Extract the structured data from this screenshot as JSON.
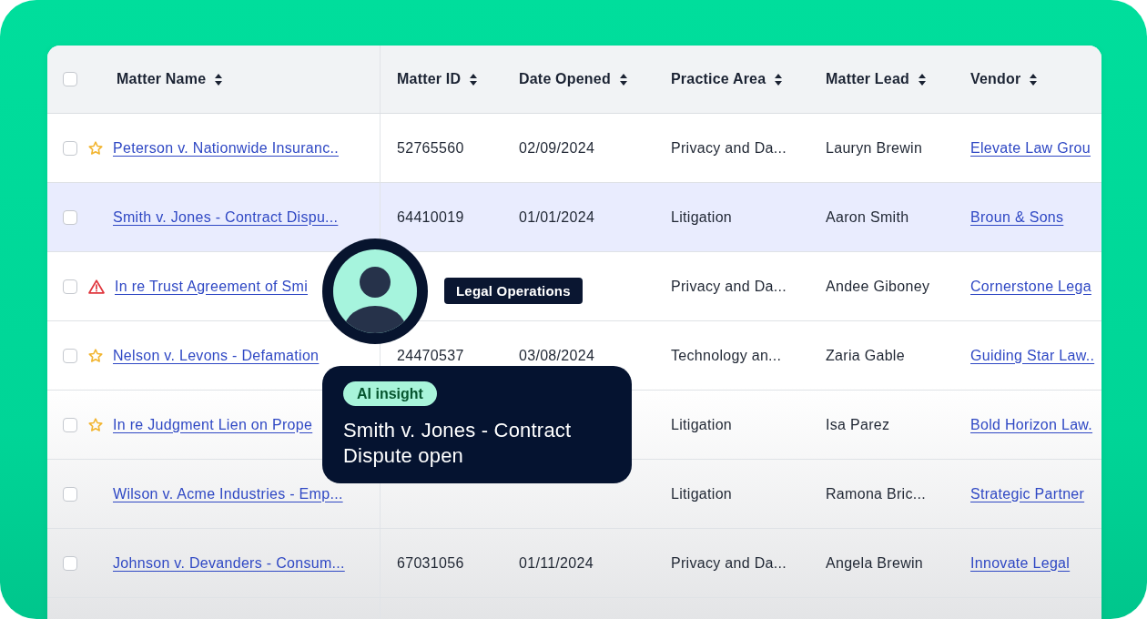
{
  "table": {
    "header_checkbox": {
      "checked": false
    },
    "columns": [
      "Matter Name",
      "Matter ID",
      "Date Opened",
      "Practice Area",
      "Matter Lead",
      "Vendor"
    ],
    "rows": [
      {
        "checked": false,
        "starred": true,
        "alert": false,
        "highlighted": false,
        "matter_name": "Peterson v. Nationwide Insuranc..",
        "matter_id": "52765560",
        "date_opened": "02/09/2024",
        "practice_area": "Privacy and Da...",
        "matter_lead": "Lauryn Brewin",
        "vendor": "Elevate Law Grou"
      },
      {
        "checked": false,
        "starred": false,
        "alert": false,
        "highlighted": true,
        "matter_name": "Smith v. Jones - Contract Dispu...",
        "matter_id": "64410019",
        "date_opened": "01/01/2024",
        "practice_area": "Litigation",
        "matter_lead": "Aaron Smith",
        "vendor": "Broun & Sons"
      },
      {
        "checked": false,
        "starred": false,
        "alert": true,
        "highlighted": false,
        "matter_name": "In re Trust Agreement of Smi",
        "practice_area": "Privacy and Da...",
        "matter_lead": "Andee Giboney",
        "vendor": "Cornerstone Lega"
      },
      {
        "checked": false,
        "starred": true,
        "alert": false,
        "highlighted": false,
        "matter_name": "Nelson v. Levons - Defamation",
        "matter_id": "24470537",
        "date_opened": "03/08/2024",
        "practice_area": "Technology an...",
        "matter_lead": "Zaria Gable",
        "vendor": "Guiding Star Law.."
      },
      {
        "checked": false,
        "starred": true,
        "alert": false,
        "highlighted": false,
        "matter_name": "In re Judgment Lien on Prope",
        "practice_area": "Litigation",
        "matter_lead": "Isa Parez",
        "vendor": "Bold Horizon Law."
      },
      {
        "checked": false,
        "starred": false,
        "alert": false,
        "highlighted": false,
        "matter_name": "Wilson v. Acme Industries - Emp...",
        "practice_area": "Litigation",
        "matter_lead": "Ramona Bric...",
        "vendor": "Strategic Partner"
      },
      {
        "checked": false,
        "starred": false,
        "alert": false,
        "highlighted": false,
        "matter_name": "Johnson v. Devanders - Consum...",
        "matter_id": "67031056",
        "date_opened": "01/11/2024",
        "practice_area": "Privacy and Da...",
        "matter_lead": "Angela Brewin",
        "vendor": "Innovate Legal"
      }
    ]
  },
  "person_tooltip": {
    "label": "Legal Operations"
  },
  "insight_card": {
    "badge": "AI insight",
    "message": "Smith v. Jones - Contract Dispute open"
  }
}
